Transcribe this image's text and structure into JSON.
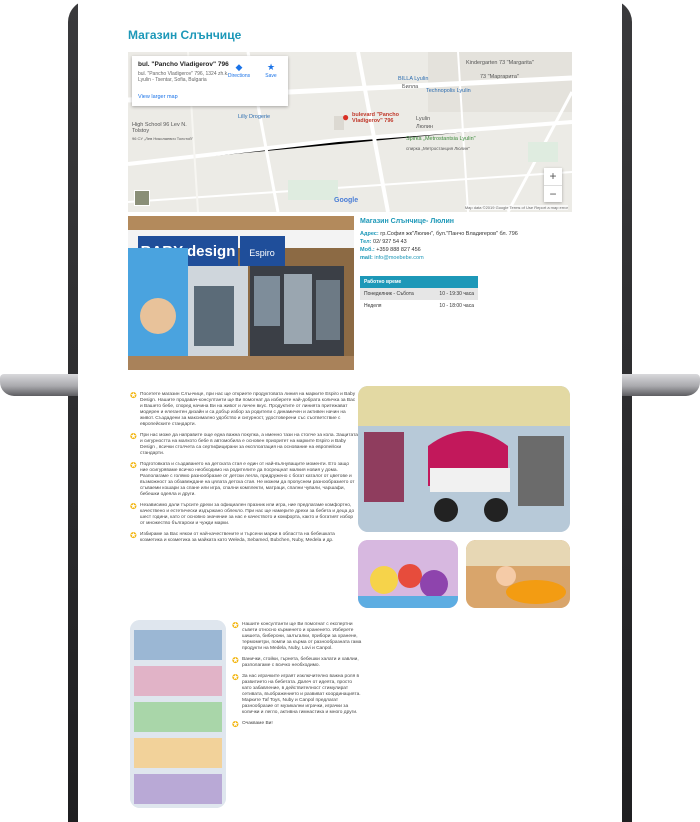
{
  "page": {
    "title": "Магазин Слънчице"
  },
  "map": {
    "card_address": "bul. \"Pancho Vladigerov\" 796",
    "card_sub": "bul. \"Pancho Vladigerov\" 796, 1324 zh.k. Lyulin - Tsentar, Sofia, Bulgaria",
    "directions_label": "Directions",
    "save_label": "Save",
    "larger_map": "View larger map",
    "pin_label": "bulevard \"Pancho Vladigerov\" 796",
    "places": {
      "kindergarten": "Kindergarten 73 \"Margarita\"",
      "kindergarten_cyr": "73 \"Маргарита\"",
      "billa": "BILLA Lyulin",
      "billa_sub": "Билла",
      "technopolis": "Technopolis Lyulin",
      "lilly": "Lilly Drogerie",
      "school": "High School 96 Lev N. Tolstoy",
      "school_sub": "96 СУ „Лев Николаевич Толстой\"",
      "lyulin": "Lyulin",
      "lyulin_cyr": "Люлин",
      "metro": "Spirka „Metrostantsia Lyulin\"",
      "metro_sub": "спирка „Метростанция Люлин\""
    },
    "zoom_in": "+",
    "zoom_out": "−",
    "google": "Google",
    "footer": "Map data ©2019 Google   Terms of Use   Report a map error"
  },
  "store": {
    "name": "Магазин Слънчице- Люлин",
    "address_label": "Адрес:",
    "address": "гр.София жк\"Люлин\", бул.\"Панчо Владигеров\" бл. 796",
    "tel_label": "Тел:",
    "tel": "02/ 927 54 43",
    "mob_label": "Моб.:",
    "mob": "+359 888 827 456",
    "mail_label": "mail:",
    "mail": "info@moebebe.com",
    "sign_text": "BABY design",
    "sign_text2": "Espiro"
  },
  "hours": {
    "header": "Работно време",
    "rows": [
      {
        "days": "Понеделник - Събота",
        "time": "10 - 19:30 часа"
      },
      {
        "days": "Неделя",
        "time": "10 - 18:00 часа"
      }
    ]
  },
  "bullets": [
    "Посетете магазин Слънчице, при нас ще откриете продуктовата линия на марките Espiro и Baby Design. Нашите продавач-консултанти ще Ви помогнат да изберете най-добрата количка за Вас и Вашето бебе, според начина Ви на живот и личен вкус. Продуктите от линията притежават модерен и елегантен дизайн и са добър избор за родители с динамичен и активен начин на живот. Създадени за максимално удобство и сигурност, удостоверени със съответствие с европейските стандарти.",
    "При нас може да направите още една важна покупка, а именно тази на столче за кола. Защитата и сигурността на малкото бебе в автомобила е основен приоритет на марките Espiro и Baby Design , всички столчета са сертифицирани за експлоатация на основание на европейски стандарти.",
    "Подготовката и създаването на детската стая е един от най-вълнуващите моменти. Ето защо ние осигуряваме всичко необходимо на родителите да посрещнат малкия новия у дома. Разполагаме с голямо разнообразие от детски легла, придружено с богат каталог от цветове и възможност за обзавеждане на цялата детска стая. Не можем да пропуснем разнообразието от сгъваеми кошари за спане или игра, спални комплекти, матраци, спални чували, чаршафи, бебешки одеяла и други.",
    "Независимо дали търсите дрехи за официален празник или игра, ние предлагаме комфортно, качествено и естетически издържано облекло. При нас ще намерите дрехи за бебета и деца до шест години, като от основно значение за нас е качеството и комфорта, както и богатият избор от множество български и чужди марки.",
    "Избираме за Вас някои от най-качествените и търсени марки в областта на бебешката козметика и козметика за майката като Weleda, Sebamed, Bubchen, Nuby, Medela и др."
  ],
  "bullets2": [
    "Нашите консултанти ще Ви помогнат с експертни съвети относно кърменето и храненето. Изберете шишета, биберони, залъгалки, прибори за хранене, термометри, помпи за кърма от разнообразната гама продукти на Medela, Nuby, Lovi и Canpol.",
    "Ванички, стойки, гърнета, бебешки халати и хавлии, разполагаме с всичко необходимо.",
    "За нас играчките играят изключително важна роля в развитието на бебетата. Далеч от идеята, просто като забавление, в действителност стимулират сетивата, въображението и развиват координацията. Марките Taf Toys, Nuby и Canpol предлагат разнообразие от музикални играчки, играчки за колички и легло, активна гимнастика и много други.",
    "Очакваме Ви!"
  ],
  "colors": {
    "accent": "#1d98b8",
    "star": "#f2b50f"
  }
}
